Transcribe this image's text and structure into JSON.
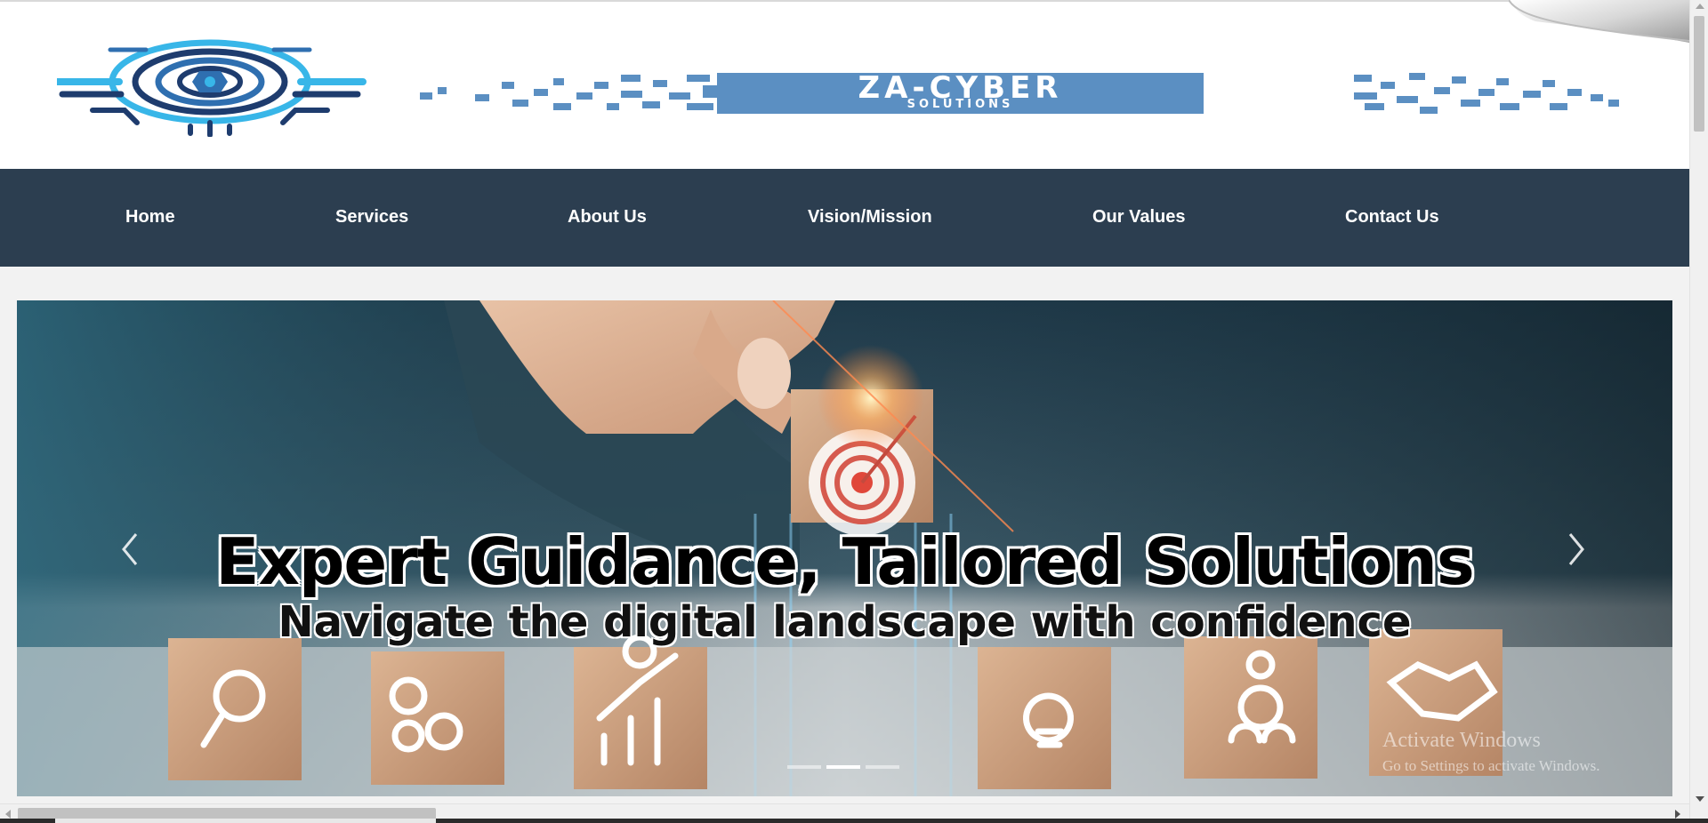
{
  "header": {
    "logo_icon": "shield-circuit-logo-icon",
    "brand_name": "ZA-CYBER",
    "brand_tagline": "SOLUTIONS",
    "colors": {
      "brand_blue": "#5b8fc2",
      "logo_dark": "#1e3c6e",
      "logo_light": "#38b6e8"
    }
  },
  "nav": {
    "background": "#2c3e50",
    "items": [
      {
        "label": "Home"
      },
      {
        "label": "Services"
      },
      {
        "label": "About Us"
      },
      {
        "label": "Vision/Mission"
      },
      {
        "label": "Our Values"
      },
      {
        "label": "Contact Us"
      }
    ]
  },
  "slider": {
    "headline": "Expert Guidance, Tailored Solutions",
    "subheadline": "Navigate the digital landscape with confidence",
    "prev_icon": "chevron-left-icon",
    "next_icon": "chevron-right-icon",
    "indicator_count": 3,
    "active_indicator": 2,
    "block_icons": [
      "magnifier-icon",
      "gears-icon",
      "growth-chart-icon",
      "target-icon",
      "lightbulb-icon",
      "network-people-icon",
      "handshake-icon"
    ]
  },
  "watermark": {
    "title": "Activate Windows",
    "subtitle": "Go to Settings to activate Windows."
  }
}
